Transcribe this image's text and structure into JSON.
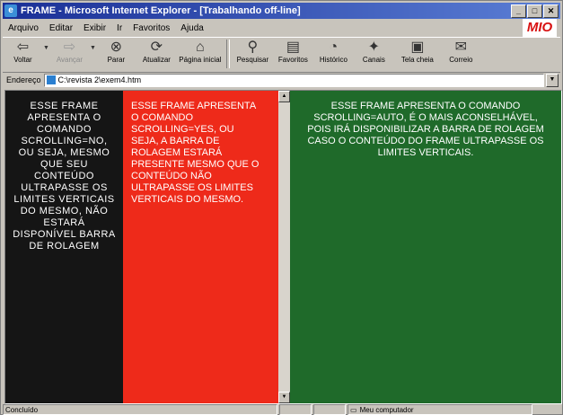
{
  "window": {
    "title": "FRAME - Microsoft Internet Explorer - [Trabalhando off-line]"
  },
  "menu": [
    "Arquivo",
    "Editar",
    "Exibir",
    "Ir",
    "Favoritos",
    "Ajuda"
  ],
  "logo_text": "MIO",
  "toolbar": {
    "back": "Voltar",
    "forward": "Avançar",
    "stop": "Parar",
    "refresh": "Atualizar",
    "home": "Página inicial",
    "search": "Pesquisar",
    "favorites": "Favoritos",
    "history": "Histórico",
    "channels": "Canais",
    "fullscreen": "Tela cheia",
    "mail": "Correio"
  },
  "address": {
    "label": "Endereço",
    "value": "C:\\revista 2\\exem4.htm"
  },
  "frames": {
    "left": "ESSE FRAME APRESENTA O COMANDO SCROLLING=NO, OU SEJA, MESMO QUE SEU CONTEÚDO ULTRAPASSE OS LIMITES VERTICAIS DO MESMO, NÃO ESTARÁ DISPONÍVEL BARRA DE ROLAGEM",
    "middle": "ESSE FRAME APRESENTA O COMANDO SCROLLING=YES, OU SEJA, A BARRA DE ROLAGEM ESTARÁ PRESENTE MESMO QUE O CONTEÚDO NÃO ULTRAPASSE OS LIMITES VERTICAIS DO MESMO.",
    "right": "ESSE FRAME APRESENTA O COMANDO SCROLLING=AUTO, É O MAIS ACONSELHÁVEL, POIS IRÁ DISPONIBILIZAR A BARRA DE ROLAGEM CASO O CONTEÚDO DO FRAME ULTRAPASSE OS LIMITES VERTICAIS."
  },
  "status": {
    "left": "Concluído",
    "zone": "Meu computador"
  },
  "colors": {
    "frame_left": "#151515",
    "frame_middle": "#ee2a1a",
    "frame_right": "#1f6a2a"
  }
}
